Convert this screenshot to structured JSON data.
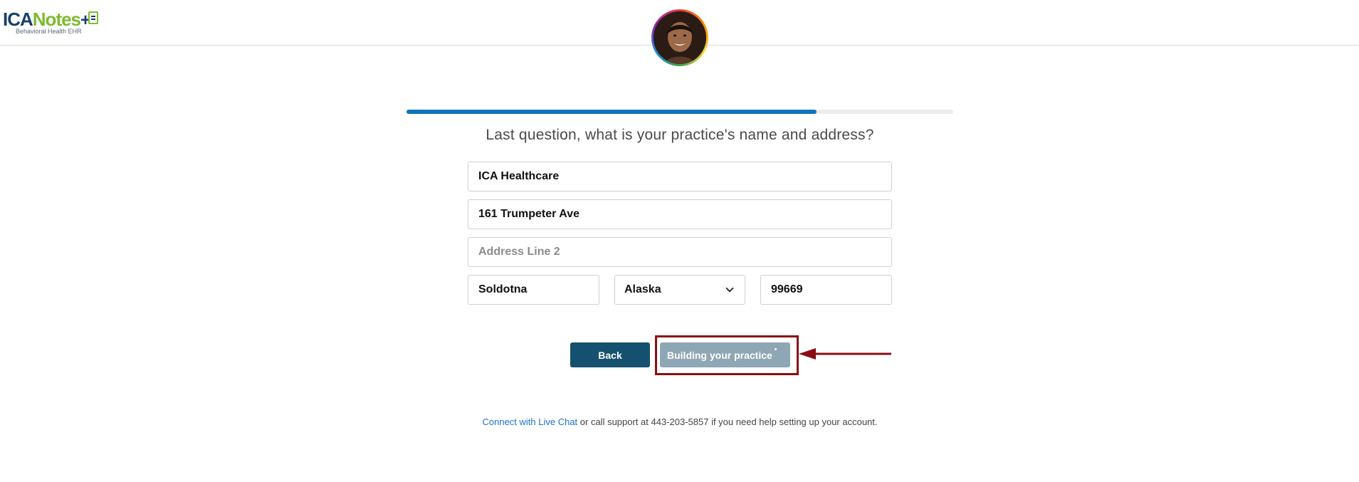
{
  "header": {
    "logo_main_ica": "ICA",
    "logo_main_notes": "Notes",
    "logo_plus": "+",
    "logo_subtitle": "Behavioral Health EHR"
  },
  "progress": {
    "value_percent": 75
  },
  "question": "Last question, what is your practice's name and address?",
  "form": {
    "practice_name": {
      "value": "ICA Healthcare",
      "placeholder": ""
    },
    "address_line1": {
      "value": "161 Trumpeter Ave",
      "placeholder": ""
    },
    "address_line2": {
      "value": "",
      "placeholder": "Address Line 2"
    },
    "city": {
      "value": "Soldotna",
      "placeholder": ""
    },
    "state": {
      "selected": "Alaska"
    },
    "zip": {
      "value": "99669",
      "placeholder": ""
    }
  },
  "buttons": {
    "back_label": "Back",
    "build_label": "Building your practice"
  },
  "support": {
    "link_text": "Connect with Live Chat",
    "text": " or call support at 443-203-5857 if you need help setting up your account."
  },
  "colors": {
    "brand_navy": "#17406b",
    "brand_green": "#7dbb2f",
    "progress_blue": "#0f75b8",
    "back_button": "#15506f",
    "build_button": "#8fa7b4",
    "annotation_red": "#8b0d14",
    "link_blue": "#1a73c8"
  },
  "icons": [
    "document-plus-icon",
    "chevron-down-icon",
    "loading-spinner-icon",
    "arrow-left-icon"
  ]
}
